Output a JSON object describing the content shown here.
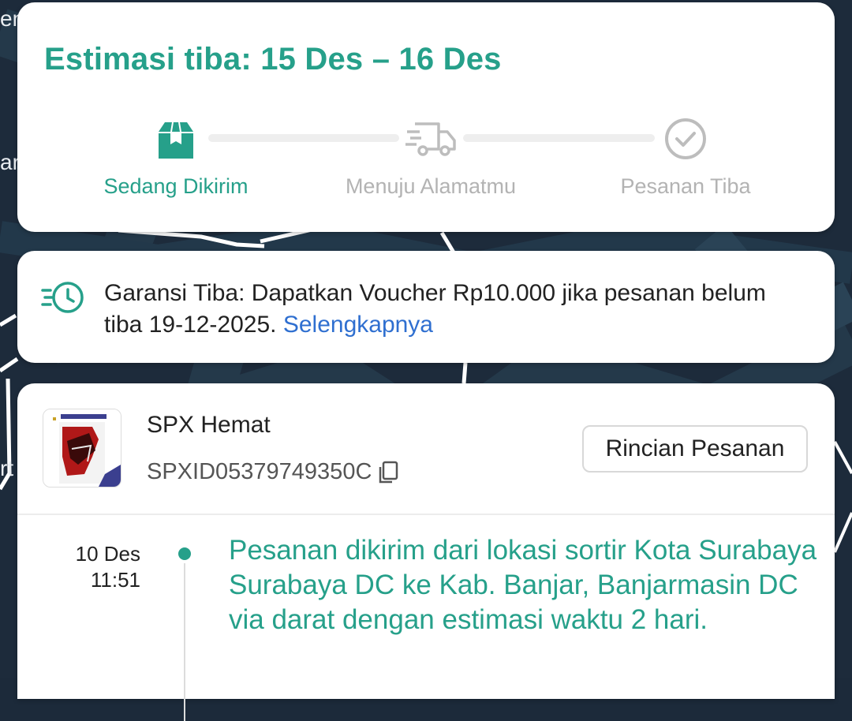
{
  "map": {
    "labels": [
      "en",
      "ar",
      "rt"
    ]
  },
  "eta": {
    "title": "Estimasi tiba: 15 Des – 16 Des",
    "steps": [
      {
        "label": "Sedang Dikirim",
        "icon": "package-icon",
        "active": true
      },
      {
        "label": "Menuju Alamatmu",
        "icon": "truck-icon",
        "active": false
      },
      {
        "label": "Pesanan Tiba",
        "icon": "check-circle-icon",
        "active": false
      }
    ]
  },
  "guarantee": {
    "icon": "fast-clock-icon",
    "text": "Garansi Tiba: Dapatkan Voucher Rp10.000 jika pesanan belum tiba 19-12-2025.",
    "link": "Selengkapnya"
  },
  "order": {
    "courier": "SPX Hemat",
    "tracking_number": "SPXID05379749350C",
    "details_button": "Rincian Pesanan",
    "timeline": [
      {
        "date": "10 Des",
        "time": "11:51",
        "text": "Pesanan dikirim dari lokasi sortir Kota Surabaya  Surabaya DC ke Kab. Banjar, Banjarmasin DC via darat dengan estimasi waktu 2 hari."
      }
    ]
  },
  "colors": {
    "accent": "#26a08a",
    "link": "#2f6fd0",
    "inactive": "#b3b3b3",
    "map_bg": "#1c2a3a"
  }
}
